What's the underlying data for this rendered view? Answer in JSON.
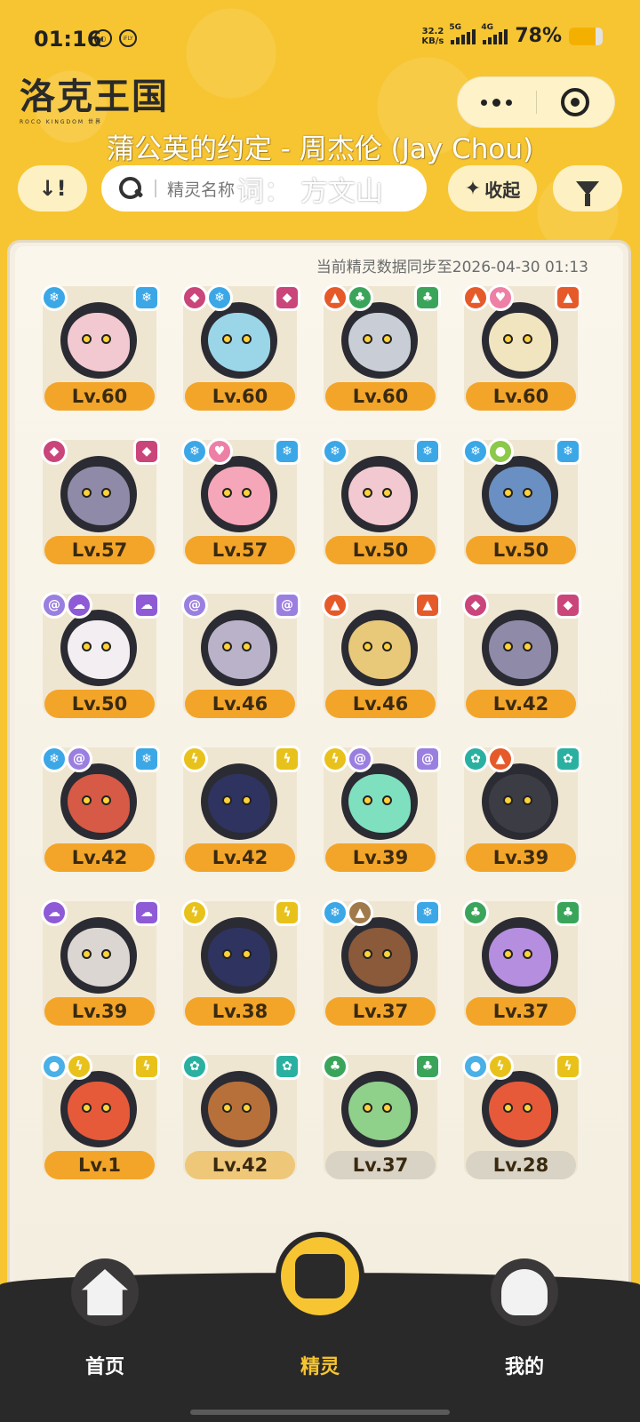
{
  "status": {
    "time": "01:16",
    "net_speed_top": "32.2",
    "net_speed_bottom": "KB/s",
    "signal1": "5G",
    "signal2": "4G",
    "battery": "78%",
    "battery_level": 0.78,
    "mini_badge": "iFLY"
  },
  "header": {
    "logo": "洛克王国",
    "logo_sub": "ROCO KINGDOM 世界",
    "lyric_top": "蒲公英的约定 - 周杰伦 (Jay Chou)"
  },
  "toolbar": {
    "sort_label": "↓!",
    "search_placeholder": "精灵名称",
    "lyric_inline": "词：  方文山",
    "collapse_label": "收起"
  },
  "sync_text": "当前精灵数据同步至2026-04-30 01:13",
  "colors": {
    "accent": "#f7c531",
    "level_bar": "#f3a52a",
    "panel": "#f5efe3",
    "nav_bg": "#2a2929"
  },
  "pets": [
    {
      "level": "Lv.60",
      "style": "normal",
      "types": [
        "ice"
      ],
      "main": "ice",
      "body": "#f2c9d0"
    },
    {
      "level": "Lv.60",
      "style": "normal",
      "types": [
        "demon",
        "ice"
      ],
      "main": "demon",
      "body": "#9ad6e8"
    },
    {
      "level": "Lv.60",
      "style": "normal",
      "types": [
        "fire",
        "grass"
      ],
      "main": "grass",
      "body": "#c9ced6"
    },
    {
      "level": "Lv.60",
      "style": "normal",
      "types": [
        "fire",
        "cute"
      ],
      "main": "fire",
      "body": "#f1e5c0"
    },
    {
      "level": "Lv.57",
      "style": "normal",
      "types": [
        "demon"
      ],
      "main": "demon",
      "body": "#8f8aa8"
    },
    {
      "level": "Lv.57",
      "style": "normal",
      "types": [
        "ice",
        "cute"
      ],
      "main": "ice",
      "body": "#f5a6b8"
    },
    {
      "level": "Lv.50",
      "style": "normal",
      "types": [
        "ice"
      ],
      "main": "ice",
      "body": "#f2c9d0"
    },
    {
      "level": "Lv.50",
      "style": "normal",
      "types": [
        "ice",
        "bug"
      ],
      "main": "ice",
      "body": "#6a8fc2"
    },
    {
      "level": "Lv.50",
      "style": "normal",
      "types": [
        "magic",
        "ghost"
      ],
      "main": "ghost",
      "body": "#f3eef2"
    },
    {
      "level": "Lv.46",
      "style": "normal",
      "types": [
        "magic"
      ],
      "main": "magic",
      "body": "#b9b2c8"
    },
    {
      "level": "Lv.46",
      "style": "normal",
      "types": [
        "fire"
      ],
      "main": "fire",
      "body": "#e8c97a"
    },
    {
      "level": "Lv.42",
      "style": "normal",
      "types": [
        "demon"
      ],
      "main": "demon",
      "body": "#8f8aa8"
    },
    {
      "level": "Lv.42",
      "style": "normal",
      "types": [
        "ice",
        "magic"
      ],
      "main": "ice",
      "body": "#d65a45"
    },
    {
      "level": "Lv.42",
      "style": "normal",
      "types": [
        "electric"
      ],
      "main": "electric",
      "body": "#2f3360"
    },
    {
      "level": "Lv.39",
      "style": "normal",
      "types": [
        "electric",
        "magic"
      ],
      "main": "magic",
      "body": "#7fe0c0"
    },
    {
      "level": "Lv.39",
      "style": "normal",
      "types": [
        "mech",
        "fire"
      ],
      "main": "mech",
      "body": "#3c3c44"
    },
    {
      "level": "Lv.39",
      "style": "normal",
      "types": [
        "ghost"
      ],
      "main": "ghost",
      "body": "#dcd6d2"
    },
    {
      "level": "Lv.38",
      "style": "normal",
      "types": [
        "electric"
      ],
      "main": "electric",
      "body": "#2f3360"
    },
    {
      "level": "Lv.37",
      "style": "normal",
      "types": [
        "ice",
        "rock"
      ],
      "main": "ice",
      "body": "#8a5a3a"
    },
    {
      "level": "Lv.37",
      "style": "normal",
      "types": [
        "grass"
      ],
      "main": "grass",
      "body": "#b58ee0"
    },
    {
      "level": "Lv.1",
      "style": "normal",
      "types": [
        "water",
        "electric"
      ],
      "main": "electric",
      "body": "#e65a3a"
    },
    {
      "level": "Lv.42",
      "style": "light",
      "types": [
        "mech"
      ],
      "main": "mech",
      "body": "#b8703a"
    },
    {
      "level": "Lv.37",
      "style": "grey",
      "types": [
        "grass"
      ],
      "main": "grass",
      "body": "#8fd08a"
    },
    {
      "level": "Lv.28",
      "style": "grey",
      "types": [
        "water",
        "electric"
      ],
      "main": "electric",
      "body": "#e65a3a"
    }
  ],
  "type_icons": {
    "ice": {
      "color": "#3ba7e6",
      "glyph": "❄",
      "icon": "ice-icon"
    },
    "demon": {
      "color": "#c9457a",
      "glyph": "◆",
      "icon": "demon-icon"
    },
    "fire": {
      "color": "#e65a2a",
      "glyph": "▲",
      "icon": "fire-icon"
    },
    "grass": {
      "color": "#3aa55a",
      "glyph": "♣",
      "icon": "grass-icon"
    },
    "cute": {
      "color": "#ee7fa5",
      "glyph": "♥",
      "icon": "cute-icon"
    },
    "bug": {
      "color": "#8cc84a",
      "glyph": "●",
      "icon": "bug-icon"
    },
    "magic": {
      "color": "#9a7fe0",
      "glyph": "@",
      "icon": "magic-icon"
    },
    "ghost": {
      "color": "#8e5ad6",
      "glyph": "☁",
      "icon": "ghost-icon"
    },
    "electric": {
      "color": "#e8c21a",
      "glyph": "ϟ",
      "icon": "electric-icon"
    },
    "mech": {
      "color": "#2ab0a0",
      "glyph": "✿",
      "icon": "mech-icon"
    },
    "rock": {
      "color": "#a07a4a",
      "glyph": "▲",
      "icon": "rock-icon"
    },
    "water": {
      "color": "#4ab0e6",
      "glyph": "●",
      "icon": "water-icon"
    }
  },
  "nav": {
    "home": "首页",
    "pets": "精灵",
    "mine": "我的"
  }
}
